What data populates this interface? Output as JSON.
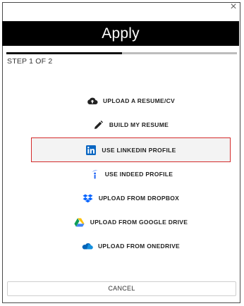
{
  "dialog": {
    "close_glyph": "×",
    "title": "Apply",
    "step": "STEP 1 OF 2",
    "progress_fraction": 0.5,
    "cancel_label": "CANCEL"
  },
  "options": [
    {
      "label": "UPLOAD A RESUME/CV",
      "icon": "cloud-upload-icon"
    },
    {
      "label": "BUILD MY RESUME",
      "icon": "pencil-icon"
    },
    {
      "label": "USE LINKEDIN PROFILE",
      "icon": "linkedin-icon",
      "selected": true
    },
    {
      "label": "USE INDEED PROFILE",
      "icon": "indeed-icon"
    },
    {
      "label": "UPLOAD FROM DROPBOX",
      "icon": "dropbox-icon"
    },
    {
      "label": "UPLOAD FROM GOOGLE DRIVE",
      "icon": "google-drive-icon"
    },
    {
      "label": "UPLOAD FROM ONEDRIVE",
      "icon": "onedrive-icon"
    }
  ],
  "colors": {
    "header_bg": "#000000",
    "selected_border": "#d42b2b",
    "linkedin": "#0a66c2",
    "indeed": "#2164f3",
    "dropbox": "#0061ff",
    "onedrive": "#0364b8"
  }
}
